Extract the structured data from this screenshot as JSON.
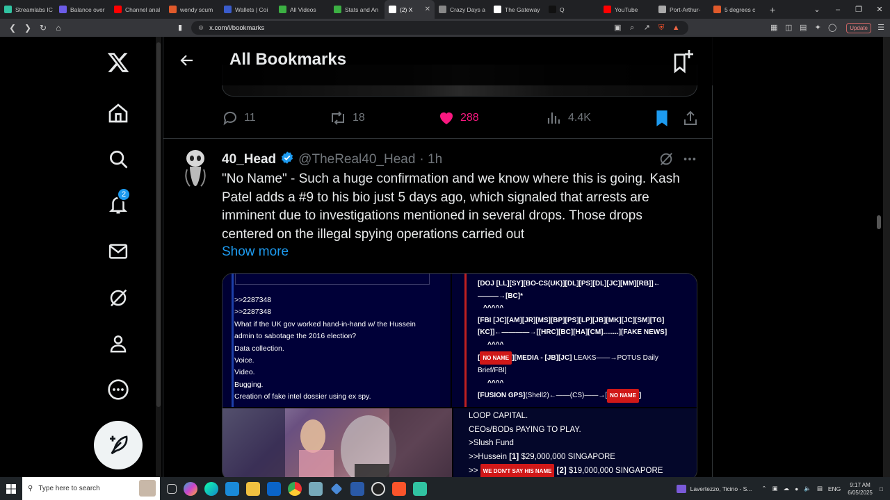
{
  "browser": {
    "tabs": [
      {
        "label": "Streamlabs IC",
        "color": "#31c3a2"
      },
      {
        "label": "Balance over",
        "color": "#6c5ce7"
      },
      {
        "label": "Channel anal",
        "color": "#ff0000"
      },
      {
        "label": "wendy scum",
        "color": "#e05a2b"
      },
      {
        "label": "Wallets | Coi",
        "color": "#3a5ccc"
      },
      {
        "label": "All Videos",
        "color": "#3cb043"
      },
      {
        "label": "Stats and An",
        "color": "#3cb043"
      },
      {
        "label": "(2) X",
        "color": "#ffffff",
        "active": true
      },
      {
        "label": "Crazy Days a",
        "color": "#888888"
      },
      {
        "label": "The Gateway",
        "color": "#ffffff"
      },
      {
        "label": "Q",
        "color": "#111111"
      },
      {
        "label": "YouTube",
        "color": "#ff0000"
      },
      {
        "label": "Port-Arthur-",
        "color": "#aaaaaa"
      },
      {
        "label": "5 degrees c",
        "color": "#e05a2b"
      }
    ],
    "url": "x.com/i/bookmarks",
    "update_label": "Update"
  },
  "sidebar": {
    "notifications_badge": "2"
  },
  "header": {
    "title": "All Bookmarks"
  },
  "prev_tweet": {
    "replies": "11",
    "reposts": "18",
    "likes": "288",
    "views": "4.4K"
  },
  "tweet": {
    "name": "40_Head",
    "handle": "@TheReal40_Head",
    "time": "· 1h",
    "text": "\"No Name\" - Such a huge confirmation and we know where this is going. Kash Patel adds a #9 to his bio just 5 days ago, which signaled that arrests are imminent due to investigations mentioned in several drops. Those drops centered on the illegal spying operations carried out",
    "show_more": "Show more"
  },
  "media": {
    "panel1_lines": [
      ">>2287348",
      ">>2287348",
      "What if the UK gov worked hand-in-hand w/ the Hussein",
      "admin to sabotage the 2016 election?",
      "Data collection.",
      "Voice.",
      "Video.",
      "Bugging.",
      "Creation of fake intel dossier using ex spy."
    ],
    "panel2": {
      "l1": "[DOJ [LL][SY][BO-CS(UK)][DL][PS][DL][JC][MM][RB]]←",
      "l2": "———→[BC]*",
      "l3": "^^^^^",
      "l4": "[FBI [JC][AM][JR][MS][BP][PS][LP][JB][MK][JC][SM][TG]",
      "l5": "[KC]]←————→[[HRC][BC][HA][CM]........][FAKE NEWS]",
      "l6": "^^^^",
      "tag1": "NO NAME",
      "l7a": "][MEDIA - [JB][JC]",
      "l7b": " LEAKS——→POTUS Daily",
      "l8": "Brief/FBI]",
      "l9": "^^^^",
      "l10a": "[FUSION GPS]",
      "l10b": "(Shell2)←——(CS)——→[",
      "tag2": "NO NAME",
      "l10c": "]"
    },
    "panel4": {
      "l1": "LOOP CAPITAL.",
      "l2": "CEOs/BODs PAYING TO PLAY.",
      "l3": ">Slush Fund",
      "l4a": ">>Hussein ",
      "l4b": "[1]",
      "l4c": " $29,000,000 SINGAPORE",
      "l5a": ">> ",
      "tag": "WE DON'T SAY HIS NAME",
      "l5b": " [2]",
      "l5c": " $19,000,000 SINGAPORE"
    }
  },
  "taskbar": {
    "search_placeholder": "Type here to search",
    "weather": "Lavertezzo, Ticino - S...",
    "lang": "ENG",
    "time": "9:17 AM",
    "date": "6/05/2025"
  },
  "colors": {
    "accent": "#1d9bf0",
    "like": "#f91880",
    "muted": "#71767b"
  }
}
